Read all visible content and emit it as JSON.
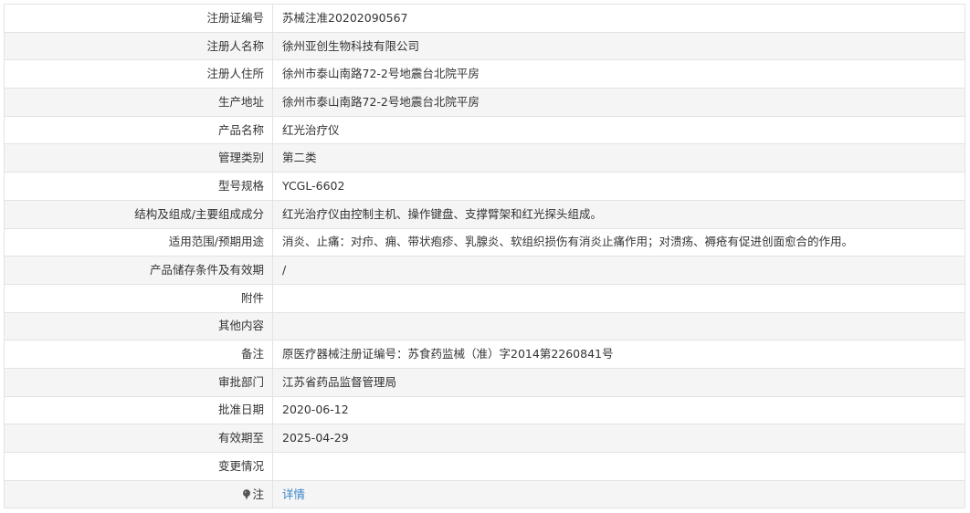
{
  "rows": [
    {
      "label": "注册证编号",
      "value": "苏械注准20202090567"
    },
    {
      "label": "注册人名称",
      "value": "徐州亚创生物科技有限公司"
    },
    {
      "label": "注册人住所",
      "value": "徐州市泰山南路72-2号地震台北院平房"
    },
    {
      "label": "生产地址",
      "value": "徐州市泰山南路72-2号地震台北院平房"
    },
    {
      "label": "产品名称",
      "value": "红光治疗仪"
    },
    {
      "label": "管理类别",
      "value": "第二类"
    },
    {
      "label": "型号规格",
      "value": "YCGL-6602"
    },
    {
      "label": "结构及组成/主要组成成分",
      "value": "红光治疗仪由控制主机、操作键盘、支撑臂架和红光探头组成。"
    },
    {
      "label": "适用范围/预期用途",
      "value": "消炎、止痛：对疖、痈、带状疱疹、乳腺炎、软组织损伤有消炎止痛作用；对溃疡、褥疮有促进创面愈合的作用。"
    },
    {
      "label": "产品储存条件及有效期",
      "value": "/"
    },
    {
      "label": "附件",
      "value": ""
    },
    {
      "label": "其他内容",
      "value": ""
    },
    {
      "label": "备注",
      "value": "原医疗器械注册证编号：苏食药监械（准）字2014第2260841号"
    },
    {
      "label": "审批部门",
      "value": "江苏省药品监督管理局"
    },
    {
      "label": "批准日期",
      "value": "2020-06-12"
    },
    {
      "label": "有效期至",
      "value": "2025-04-29"
    },
    {
      "label": "变更情况",
      "value": ""
    }
  ],
  "note_row": {
    "label": "注",
    "icon": "pin-icon",
    "link_text": "详情"
  }
}
